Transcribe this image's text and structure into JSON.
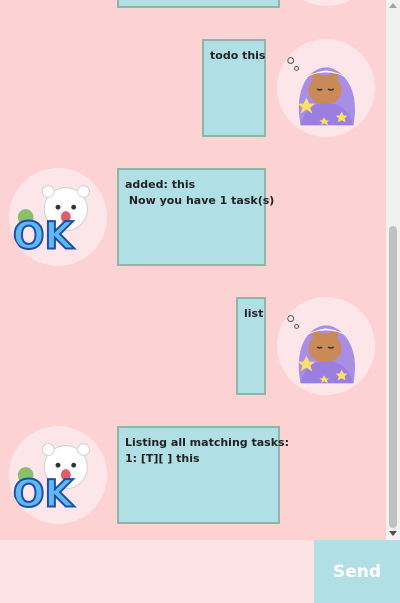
{
  "messages": [
    {
      "sender": "user",
      "text": ""
    },
    {
      "sender": "user",
      "text": "todo this"
    },
    {
      "sender": "duke",
      "text": "added: this\n Now you have 1 task(s)"
    },
    {
      "sender": "user",
      "text": "list"
    },
    {
      "sender": "duke",
      "text": "Listing all matching tasks:\n1: [T][ ] this"
    }
  ],
  "input": {
    "value": "",
    "placeholder": ""
  },
  "send_label": "Send",
  "colors": {
    "background": "#fcd2d2",
    "bubble": "#b0e0e6",
    "bubble_border": "#8cb7a8",
    "send": "#b0e0e6",
    "input": "#fde3e3"
  },
  "icons": {
    "user_avatar": "bear-in-blanket-icon",
    "bot_avatar": "bear-ok-icon"
  }
}
